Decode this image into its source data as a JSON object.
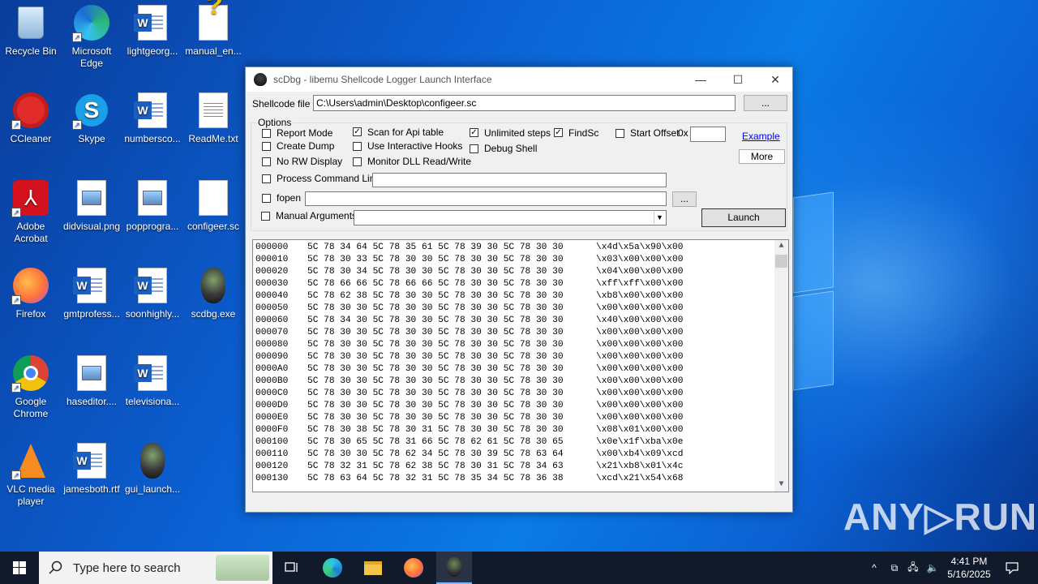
{
  "desktop": {
    "icons": [
      {
        "label": "Recycle Bin",
        "icon": "recycle-bin-icon"
      },
      {
        "label": "Microsoft Edge",
        "icon": "edge-icon"
      },
      {
        "label": "lightgeorg...",
        "icon": "word-doc-icon"
      },
      {
        "label": "manual_en...",
        "icon": "help-doc-icon"
      },
      {
        "label": "CCleaner",
        "icon": "ccleaner-icon"
      },
      {
        "label": "Skype",
        "icon": "skype-icon"
      },
      {
        "label": "numbersco...",
        "icon": "word-doc-icon"
      },
      {
        "label": "ReadMe.txt",
        "icon": "text-file-icon"
      },
      {
        "label": "Adobe Acrobat",
        "icon": "acrobat-icon"
      },
      {
        "label": "didvisual.png",
        "icon": "image-file-icon"
      },
      {
        "label": "popprogra...",
        "icon": "image-file-icon"
      },
      {
        "label": "configeer.sc",
        "icon": "blank-file-icon"
      },
      {
        "label": "Firefox",
        "icon": "firefox-icon"
      },
      {
        "label": "gmtprofess...",
        "icon": "word-doc-icon"
      },
      {
        "label": "soonhighly...",
        "icon": "word-doc-icon"
      },
      {
        "label": "scdbg.exe",
        "icon": "scdbg-icon"
      },
      {
        "label": "Google Chrome",
        "icon": "chrome-icon"
      },
      {
        "label": "haseditor....",
        "icon": "image-file-icon"
      },
      {
        "label": "televisiona...",
        "icon": "word-doc-icon"
      },
      {
        "label": "VLC media player",
        "icon": "vlc-icon"
      },
      {
        "label": "jamesboth.rtf",
        "icon": "word-doc-icon"
      },
      {
        "label": "gui_launch...",
        "icon": "scdbg-icon"
      }
    ]
  },
  "window": {
    "title": "scDbg - libemu Shellcode Logger Launch Interface",
    "minimize": "—",
    "maximize": "☐",
    "close": "✕",
    "shellcode_label": "Shellcode file",
    "shellcode_path": "C:\\Users\\admin\\Desktop\\configeer.sc",
    "browse_label": "...",
    "options_label": "Options",
    "report_mode": "Report Mode",
    "create_dump": "Create Dump",
    "no_rw_display": "No RW Display",
    "scan_api": "Scan for Api table",
    "interactive_hooks": "Use Interactive Hooks",
    "monitor_dll": "Monitor DLL Read/Write",
    "unlimited_steps": "Unlimited steps",
    "debug_shell": "Debug Shell",
    "findsc": "FindSc",
    "start_offset": "Start Offset",
    "offset_prefix": "0x",
    "offset_value": "",
    "example_link": "Example",
    "more_button": "More",
    "process_cmd": "Process Command Line",
    "process_cmd_value": "",
    "fopen": "fopen",
    "fopen_value": "",
    "fopen_browse": "...",
    "manual": "Manual",
    "arguments": "Arguments",
    "arguments_value": "",
    "launch_button": "Launch",
    "checked_mark": "✓"
  },
  "hex_rows": [
    {
      "offset": "000000",
      "hex": "5C 78 34 64 5C 78 35 61 5C 78 39 30 5C 78 30 30",
      "ascii": "\\x4d\\x5a\\x90\\x00"
    },
    {
      "offset": "000010",
      "hex": "5C 78 30 33 5C 78 30 30 5C 78 30 30 5C 78 30 30",
      "ascii": "\\x03\\x00\\x00\\x00"
    },
    {
      "offset": "000020",
      "hex": "5C 78 30 34 5C 78 30 30 5C 78 30 30 5C 78 30 30",
      "ascii": "\\x04\\x00\\x00\\x00"
    },
    {
      "offset": "000030",
      "hex": "5C 78 66 66 5C 78 66 66 5C 78 30 30 5C 78 30 30",
      "ascii": "\\xff\\xff\\x00\\x00"
    },
    {
      "offset": "000040",
      "hex": "5C 78 62 38 5C 78 30 30 5C 78 30 30 5C 78 30 30",
      "ascii": "\\xb8\\x00\\x00\\x00"
    },
    {
      "offset": "000050",
      "hex": "5C 78 30 30 5C 78 30 30 5C 78 30 30 5C 78 30 30",
      "ascii": "\\x00\\x00\\x00\\x00"
    },
    {
      "offset": "000060",
      "hex": "5C 78 34 30 5C 78 30 30 5C 78 30 30 5C 78 30 30",
      "ascii": "\\x40\\x00\\x00\\x00"
    },
    {
      "offset": "000070",
      "hex": "5C 78 30 30 5C 78 30 30 5C 78 30 30 5C 78 30 30",
      "ascii": "\\x00\\x00\\x00\\x00"
    },
    {
      "offset": "000080",
      "hex": "5C 78 30 30 5C 78 30 30 5C 78 30 30 5C 78 30 30",
      "ascii": "\\x00\\x00\\x00\\x00"
    },
    {
      "offset": "000090",
      "hex": "5C 78 30 30 5C 78 30 30 5C 78 30 30 5C 78 30 30",
      "ascii": "\\x00\\x00\\x00\\x00"
    },
    {
      "offset": "0000A0",
      "hex": "5C 78 30 30 5C 78 30 30 5C 78 30 30 5C 78 30 30",
      "ascii": "\\x00\\x00\\x00\\x00"
    },
    {
      "offset": "0000B0",
      "hex": "5C 78 30 30 5C 78 30 30 5C 78 30 30 5C 78 30 30",
      "ascii": "\\x00\\x00\\x00\\x00"
    },
    {
      "offset": "0000C0",
      "hex": "5C 78 30 30 5C 78 30 30 5C 78 30 30 5C 78 30 30",
      "ascii": "\\x00\\x00\\x00\\x00"
    },
    {
      "offset": "0000D0",
      "hex": "5C 78 30 30 5C 78 30 30 5C 78 30 30 5C 78 30 30",
      "ascii": "\\x00\\x00\\x00\\x00"
    },
    {
      "offset": "0000E0",
      "hex": "5C 78 30 30 5C 78 30 30 5C 78 30 30 5C 78 30 30",
      "ascii": "\\x00\\x00\\x00\\x00"
    },
    {
      "offset": "0000F0",
      "hex": "5C 78 30 38 5C 78 30 31 5C 78 30 30 5C 78 30 30",
      "ascii": "\\x08\\x01\\x00\\x00"
    },
    {
      "offset": "000100",
      "hex": "5C 78 30 65 5C 78 31 66 5C 78 62 61 5C 78 30 65",
      "ascii": "\\x0e\\x1f\\xba\\x0e"
    },
    {
      "offset": "000110",
      "hex": "5C 78 30 30 5C 78 62 34 5C 78 30 39 5C 78 63 64",
      "ascii": "\\x00\\xb4\\x09\\xcd"
    },
    {
      "offset": "000120",
      "hex": "5C 78 32 31 5C 78 62 38 5C 78 30 31 5C 78 34 63",
      "ascii": "\\x21\\xb8\\x01\\x4c"
    },
    {
      "offset": "000130",
      "hex": "5C 78 63 64 5C 78 32 31 5C 78 35 34 5C 78 36 38",
      "ascii": "\\xcd\\x21\\x54\\x68"
    }
  ],
  "scroll": {
    "up": "▲",
    "down": "▼"
  },
  "taskbar": {
    "search_placeholder": "Type here to search",
    "time": "4:41 PM",
    "date": "5/16/2025"
  },
  "watermark": "ANY▷RUN",
  "colors": {
    "accent": "#0b5fd1",
    "taskbar": "#101a2a"
  }
}
